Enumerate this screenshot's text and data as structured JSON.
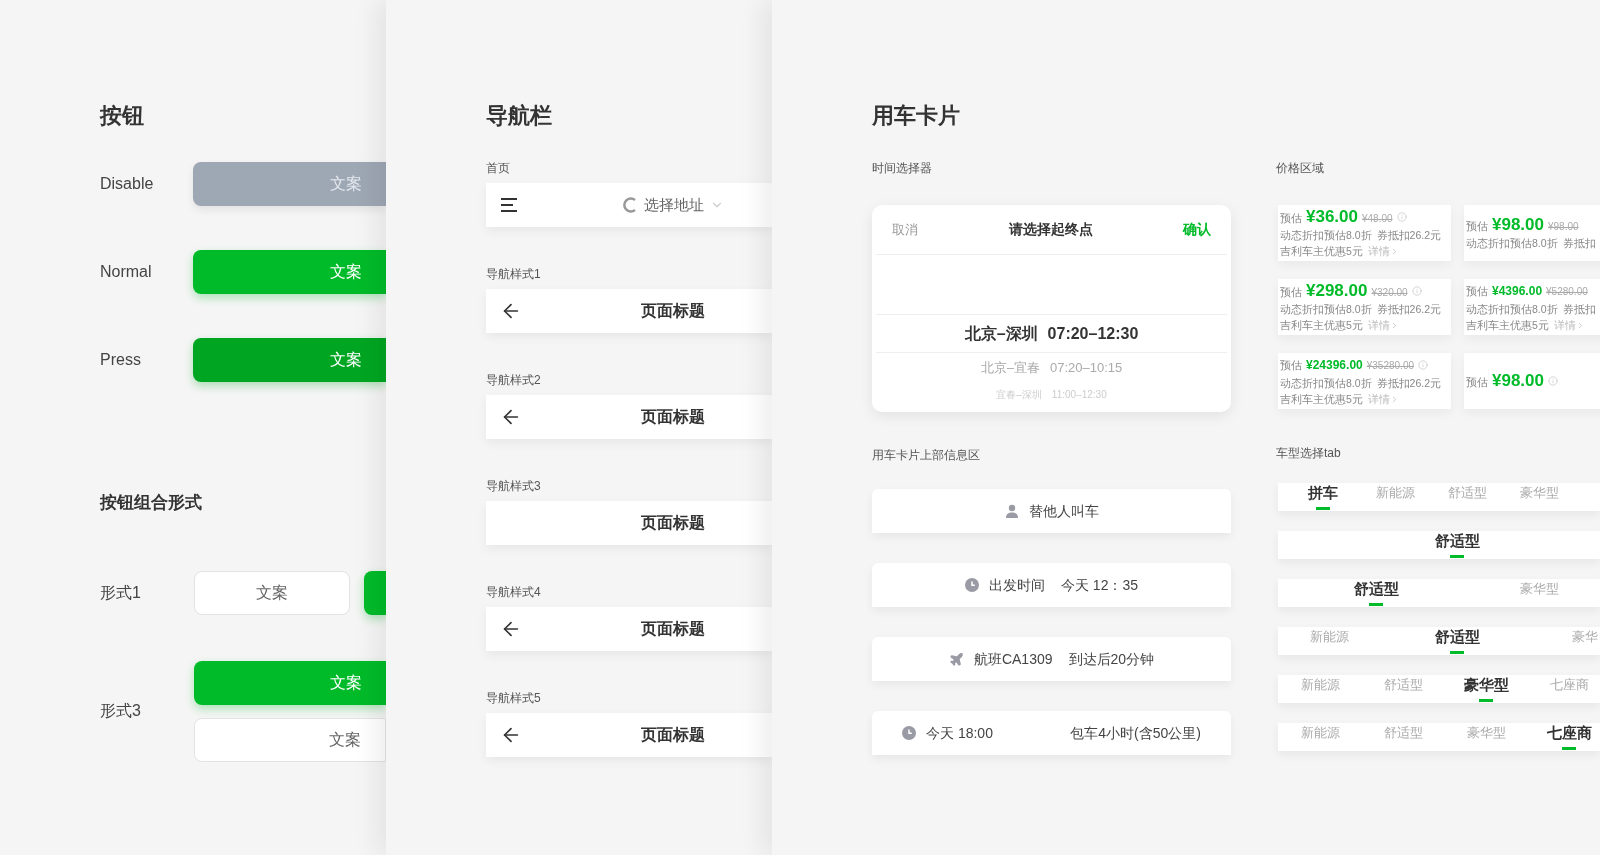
{
  "buttons_panel": {
    "title": "按钮",
    "states": [
      {
        "label": "Disable",
        "kind": "disabled",
        "text": "文案"
      },
      {
        "label": "Normal",
        "kind": "normal",
        "text": "文案"
      },
      {
        "label": "Press",
        "kind": "pressed",
        "text": "文案"
      }
    ],
    "group_title": "按钮组合形式",
    "groups": [
      {
        "label": "形式1",
        "kind": "row",
        "buttons": [
          {
            "kind": "secondary",
            "text": "文案"
          },
          {
            "kind": "primary"
          }
        ]
      },
      {
        "label": "形式3",
        "kind": "column",
        "buttons": [
          {
            "kind": "primary",
            "text": "文案"
          },
          {
            "kind": "secondary",
            "text": "文案"
          }
        ]
      }
    ]
  },
  "nav_panel": {
    "title": "导航栏",
    "bars": [
      {
        "label": "首页",
        "kind": "home",
        "text": "选择地址"
      },
      {
        "label": "导航样式1",
        "kind": "back",
        "text": "页面标题"
      },
      {
        "label": "导航样式2",
        "kind": "back",
        "text": "页面标题"
      },
      {
        "label": "导航样式3",
        "kind": "plain",
        "text": "页面标题"
      },
      {
        "label": "导航样式4",
        "kind": "back",
        "text": "页面标题"
      },
      {
        "label": "导航样式5",
        "kind": "back",
        "text": "页面标题"
      }
    ]
  },
  "car_panel": {
    "title": "用车卡片",
    "picker": {
      "label": "时间选择器",
      "cancel": "取消",
      "title": "请选择起终点",
      "confirm": "确认",
      "options": [
        {
          "route": "北京–深圳",
          "time": "07:20–12:30",
          "selected": true
        },
        {
          "route": "北京–宜春",
          "time": "07:20–10:15",
          "selected": false
        },
        {
          "route": "宜春–深圳",
          "time": "11:00–12:30",
          "selected": false
        }
      ]
    },
    "info": {
      "label": "用车卡片上部信息区",
      "cards": [
        {
          "kind": "person",
          "texts": [
            "替他人叫车"
          ]
        },
        {
          "kind": "clock",
          "texts": [
            "出发时间",
            "今天 12：35"
          ]
        },
        {
          "kind": "plane",
          "texts": [
            "航班CA1309",
            "到达后20分钟"
          ]
        },
        {
          "kind": "charter",
          "texts": [
            "今天 18:00",
            "包车4小时(含50公里)"
          ]
        }
      ]
    },
    "price": {
      "label": "价格区域",
      "cards": [
        {
          "label": "预估",
          "price": "¥36.00",
          "original": "¥48.00",
          "info": true,
          "discount": "动态折扣预估8.0折",
          "coupon": "券抵扣26.2元",
          "perk": "吉利车主优惠5元",
          "details": "详情"
        },
        {
          "label": "预估",
          "price": "¥98.00",
          "original": "¥98.00",
          "info": false,
          "discount": "动态折扣预估8.0折",
          "coupon": "券抵扣"
        },
        {
          "label": "预估",
          "price": "¥298.00",
          "original": "¥320.00",
          "info": true,
          "discount": "动态折扣预估8.0折",
          "coupon": "券抵扣26.2元",
          "perk": "吉利车主优惠5元",
          "details": "详情"
        },
        {
          "label": "预估",
          "price": "¥4396.00",
          "original": "¥5280.00",
          "info": false,
          "discount": "动态折扣预估8.0折",
          "coupon": "券抵扣",
          "perk": "吉利车主优惠5元",
          "details": "详情"
        },
        {
          "label": "预估",
          "price": "¥24396.00",
          "original": "¥35280.00",
          "info": true,
          "discount": "动态折扣预估8.0折",
          "coupon": "券抵扣26.2元",
          "perk": "吉利车主优惠5元",
          "details": "详情"
        },
        {
          "label": "预估",
          "price": "¥98.00",
          "info": true
        }
      ]
    },
    "tabs": {
      "label": "车型选择tab",
      "rows": [
        {
          "tabs": [
            {
              "text": "拼车",
              "selected": true
            },
            {
              "text": "新能源",
              "selected": false
            },
            {
              "text": "舒适型",
              "selected": false
            },
            {
              "text": "豪华型",
              "selected": false
            }
          ]
        },
        {
          "tabs": [
            {
              "text": "舒适型",
              "selected": true
            }
          ]
        },
        {
          "tabs": [
            {
              "text": "舒适型",
              "selected": true
            },
            {
              "text": "豪华型",
              "selected": false
            }
          ]
        },
        {
          "tabs": [
            {
              "text": "新能源",
              "selected": false
            },
            {
              "text": "舒适型",
              "selected": true
            },
            {
              "text": "豪华",
              "selected": false
            }
          ]
        },
        {
          "tabs": [
            {
              "text": "新能源",
              "selected": false
            },
            {
              "text": "舒适型",
              "selected": false
            },
            {
              "text": "豪华型",
              "selected": true
            },
            {
              "text": "七座商",
              "selected": false
            }
          ]
        },
        {
          "tabs": [
            {
              "text": "新能源",
              "selected": false
            },
            {
              "text": "舒适型",
              "selected": false
            },
            {
              "text": "豪华型",
              "selected": false
            },
            {
              "text": "七座商",
              "selected": true
            }
          ]
        }
      ]
    }
  }
}
